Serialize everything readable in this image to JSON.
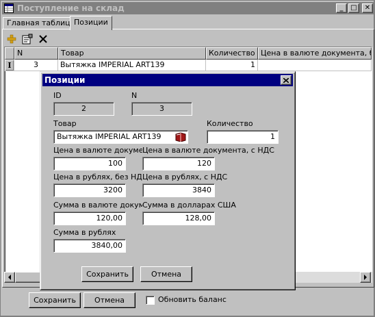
{
  "window": {
    "title": "Поступление на склад",
    "controls": {
      "minimize": "_",
      "maximize": "□",
      "close": "✕"
    }
  },
  "tabs": [
    {
      "label": "Главная таблица",
      "active": false
    },
    {
      "label": "Позиции",
      "active": true
    }
  ],
  "toolbar": {
    "add_icon": "plus-icon",
    "edit_icon": "edit-properties-icon",
    "delete_icon": "delete-x-icon"
  },
  "grid": {
    "columns": [
      "N",
      "Товар",
      "Количество",
      "Цена в валюте документа, без"
    ],
    "rows": [
      {
        "indicator": "I",
        "n": "3",
        "product": "Вытяжка IMPERIAL ART139",
        "qty": "1",
        "price": ""
      }
    ]
  },
  "dialog": {
    "title": "Позиции",
    "id_label": "ID",
    "id_value": "2",
    "n_label": "N",
    "n_value": "3",
    "product_label": "Товар",
    "product_value": "Вытяжка IMPERIAL ART139",
    "qty_label": "Количество",
    "qty_value": "1",
    "price_doc_label": "Цена в валюте документа",
    "price_doc_value": "100",
    "price_doc_vat_label": "Цена в валюте документа, с НДС",
    "price_doc_vat_value": "120",
    "price_rub_label": "Цена в рублях, без НДС",
    "price_rub_value": "3200",
    "price_rub_vat_label": "Цена в рублях, с НДС",
    "price_rub_vat_value": "3840",
    "sum_doc_label": "Сумма в валюте документа",
    "sum_doc_value": "120,00",
    "sum_usd_label": "Сумма в долларах США",
    "sum_usd_value": "128,00",
    "sum_rub_label": "Сумма в рублях",
    "sum_rub_value": "3840,00",
    "save_label": "Сохранить",
    "cancel_label": "Отмена"
  },
  "footer": {
    "save_label": "Сохранить",
    "cancel_label": "Отмена",
    "update_balance_label": "Обновить баланс",
    "update_balance_checked": false
  },
  "colors": {
    "face": "#c0c0c0",
    "inactive_title": "#808080",
    "active_title": "#000080",
    "add_icon": "#d4a017",
    "delete_icon": "#000000"
  }
}
